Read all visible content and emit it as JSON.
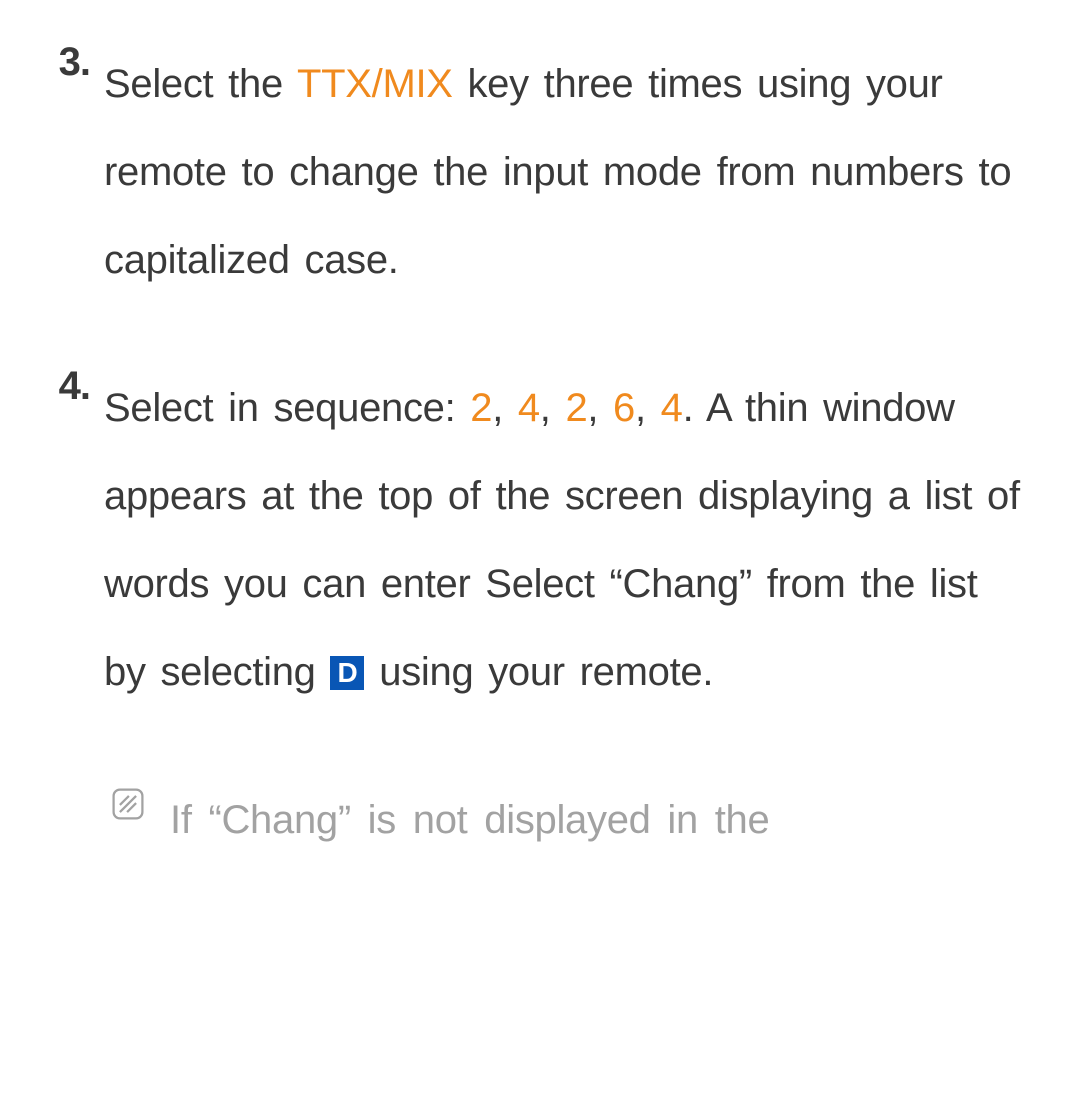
{
  "items": [
    {
      "marker": "3.",
      "segments": [
        {
          "text": "Select the "
        },
        {
          "text": "TTX/MIX",
          "highlight": true
        },
        {
          "text": " key three times using your remote to change the input mode from numbers to capitalized case."
        }
      ]
    },
    {
      "marker": "4.",
      "segments": [
        {
          "text": "Select in sequence: "
        },
        {
          "text": "2",
          "highlight": true
        },
        {
          "text": ", "
        },
        {
          "text": "4",
          "highlight": true
        },
        {
          "text": ", "
        },
        {
          "text": "2",
          "highlight": true
        },
        {
          "text": ", "
        },
        {
          "text": "6",
          "highlight": true
        },
        {
          "text": ", "
        },
        {
          "text": "4",
          "highlight": true
        },
        {
          "text": ". A thin window appears at the top of the screen displaying a list of words you can enter Select “Chang” from the list by selecting "
        },
        {
          "dbutton": "D"
        },
        {
          "text": " using your remote."
        }
      ]
    }
  ],
  "note": {
    "text": "If “Chang” is not displayed in the"
  }
}
